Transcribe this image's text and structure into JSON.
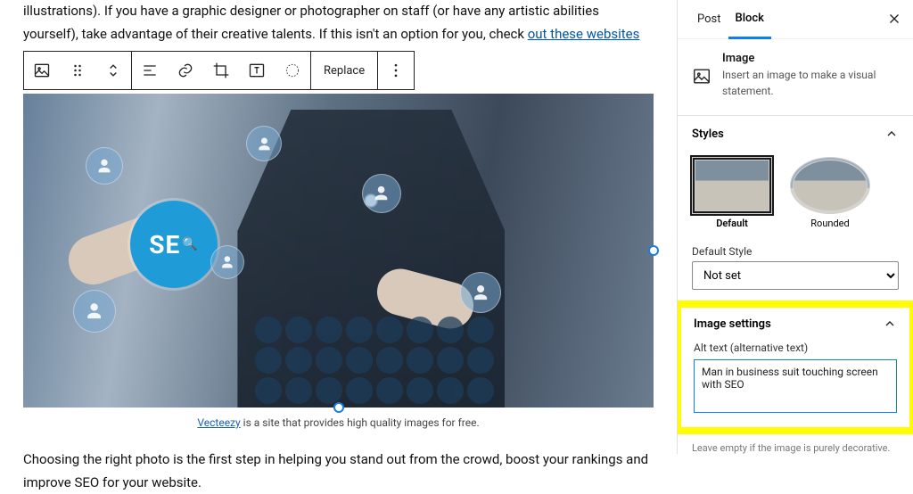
{
  "editor": {
    "para_top_fragment": "illustrations). If you have a graphic designer or photographer on staff (or have any artistic abilities yourself), take advantage of their creative talents. If this isn't an option for you, check ",
    "para_top_link": "out these websites",
    "caption_link": "Vecteezy",
    "caption_rest": " is a site that provides high quality images for free.",
    "para_bottom": "Choosing the right photo is the first step in helping you stand out from the crowd, boost your rankings and improve SEO for your website.",
    "seo_badge": "SE",
    "toolbar": {
      "replace": "Replace"
    }
  },
  "sidebar": {
    "tabs": {
      "post": "Post",
      "block": "Block"
    },
    "block_header": {
      "title": "Image",
      "desc": "Insert an image to make a visual statement."
    },
    "styles": {
      "title": "Styles",
      "opts": [
        "Default",
        "Rounded"
      ],
      "label": "Default Style",
      "select": "Not set"
    },
    "image_settings": {
      "title": "Image settings",
      "alt_label": "Alt text (alternative text)",
      "alt_value": "Man in business suit touching screen with SEO",
      "note": "Leave empty if the image is purely decorative."
    }
  }
}
